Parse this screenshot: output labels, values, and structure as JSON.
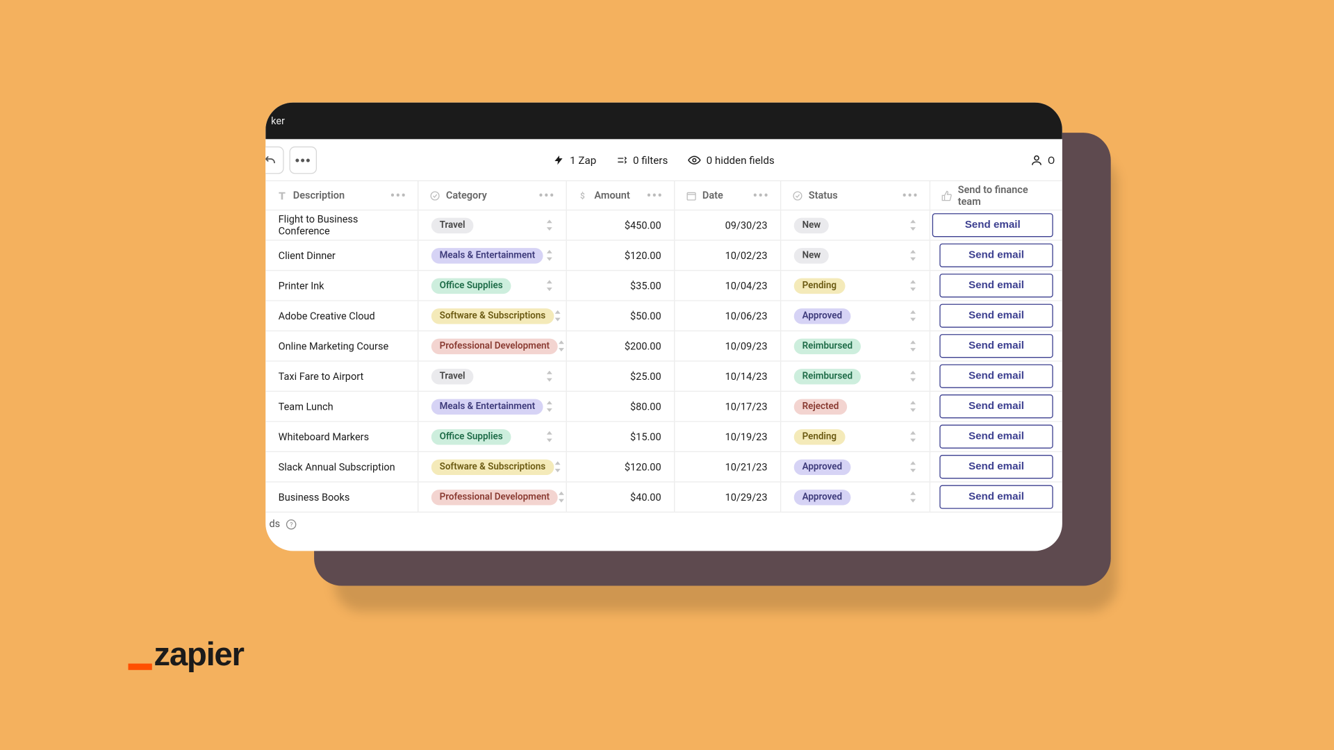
{
  "app_title_suffix": "ker",
  "toolbar": {
    "zap_count": "1 Zap",
    "filters": "0 filters",
    "hidden_fields": "0 hidden fields",
    "collab_suffix": "O"
  },
  "columns": {
    "description": "Description",
    "category": "Category",
    "amount": "Amount",
    "date": "Date",
    "status": "Status",
    "send": "Send to finance team"
  },
  "send_button_label": "Send email",
  "footer_suffix": "ds",
  "logo_text": "zapier",
  "category_classes": {
    "Travel": "tag-travel",
    "Meals & Entertainment": "tag-meals",
    "Office Supplies": "tag-office",
    "Software & Subscriptions": "tag-software",
    "Professional Development": "tag-profdev"
  },
  "status_classes": {
    "New": "tag-new",
    "Pending": "tag-pending",
    "Approved": "tag-approved",
    "Reimbursed": "tag-reimbursed",
    "Rejected": "tag-rejected"
  },
  "rows": [
    {
      "description": "Flight to Business Conference",
      "category": "Travel",
      "amount": "$450.00",
      "date": "09/30/23",
      "status": "New"
    },
    {
      "description": "Client Dinner",
      "category": "Meals & Entertainment",
      "amount": "$120.00",
      "date": "10/02/23",
      "status": "New"
    },
    {
      "description": "Printer Ink",
      "category": "Office Supplies",
      "amount": "$35.00",
      "date": "10/04/23",
      "status": "Pending"
    },
    {
      "description": "Adobe Creative Cloud",
      "category": "Software & Subscriptions",
      "amount": "$50.00",
      "date": "10/06/23",
      "status": "Approved"
    },
    {
      "description": "Online Marketing Course",
      "category": "Professional Development",
      "amount": "$200.00",
      "date": "10/09/23",
      "status": "Reimbursed"
    },
    {
      "description": "Taxi Fare to Airport",
      "category": "Travel",
      "amount": "$25.00",
      "date": "10/14/23",
      "status": "Reimbursed"
    },
    {
      "description": "Team Lunch",
      "category": "Meals & Entertainment",
      "amount": "$80.00",
      "date": "10/17/23",
      "status": "Rejected"
    },
    {
      "description": "Whiteboard Markers",
      "category": "Office Supplies",
      "amount": "$15.00",
      "date": "10/19/23",
      "status": "Pending"
    },
    {
      "description": "Slack Annual Subscription",
      "category": "Software & Subscriptions",
      "amount": "$120.00",
      "date": "10/21/23",
      "status": "Approved"
    },
    {
      "description": "Business Books",
      "category": "Professional Development",
      "amount": "$40.00",
      "date": "10/29/23",
      "status": "Approved"
    }
  ]
}
